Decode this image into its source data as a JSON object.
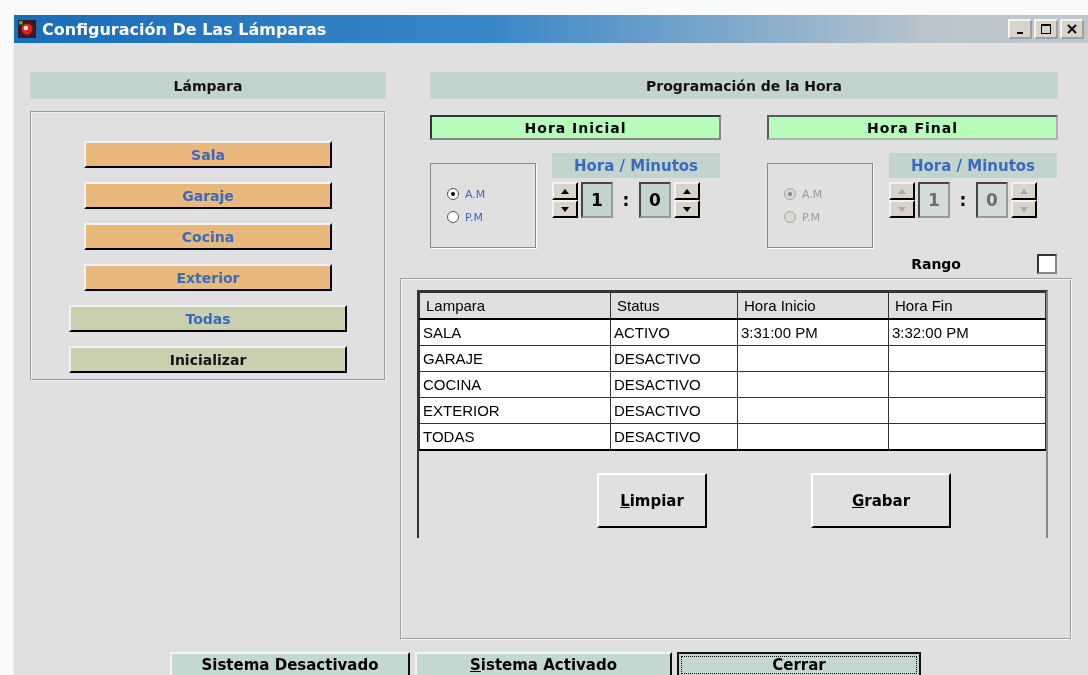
{
  "window": {
    "title": "Configuración De Las Lámparas"
  },
  "lamp_panel": {
    "heading": "Lámpara",
    "buttons": [
      {
        "label": "Sala",
        "kind": "lamp"
      },
      {
        "label": "Garaje",
        "kind": "lamp"
      },
      {
        "label": "Cocina",
        "kind": "lamp"
      },
      {
        "label": "Exterior",
        "kind": "lamp"
      },
      {
        "label": "Todas",
        "kind": "all"
      },
      {
        "label": "Inicializar",
        "kind": "reset"
      }
    ]
  },
  "schedule": {
    "heading": "Programación de la Hora",
    "times": [
      {
        "title": "Hora Inicial",
        "disabled": false,
        "options": [
          {
            "label": "A.M",
            "selected": true
          },
          {
            "label": "P.M",
            "selected": false
          }
        ],
        "spinner_label": "Hora / Minutos",
        "hour": "1",
        "separator": ":",
        "minute": "0"
      },
      {
        "title": "Hora Final",
        "disabled": true,
        "options": [
          {
            "label": "A.M",
            "selected": true
          },
          {
            "label": "P.M",
            "selected": false
          }
        ],
        "spinner_label": "Hora / Minutos",
        "hour": "1",
        "separator": ":",
        "minute": "0"
      }
    ],
    "range": {
      "label": "Rango",
      "checked": false
    }
  },
  "table": {
    "columns": [
      "Lampara",
      "Status",
      "Hora Inicio",
      "Hora Fin"
    ],
    "rows": [
      [
        "SALA",
        "ACTIVO",
        "3:31:00 PM",
        "3:32:00 PM"
      ],
      [
        "GARAJE",
        "DESACTIVO",
        "",
        ""
      ],
      [
        "COCINA",
        "DESACTIVO",
        "",
        ""
      ],
      [
        "EXTERIOR",
        "DESACTIVO",
        "",
        ""
      ],
      [
        "TODAS",
        "DESACTIVO",
        "",
        ""
      ]
    ]
  },
  "table_buttons": [
    {
      "label": "Limpiar",
      "underline_first": true
    },
    {
      "label": "Grabar",
      "underline_first": true
    }
  ],
  "footer_buttons": [
    {
      "label": "Sistema Desactivado",
      "underline_first": false,
      "focused": false
    },
    {
      "label": "Sistema Activado",
      "underline_first": true,
      "focused": false
    },
    {
      "label": "Cerrar",
      "underline_first": false,
      "focused": true
    }
  ]
}
